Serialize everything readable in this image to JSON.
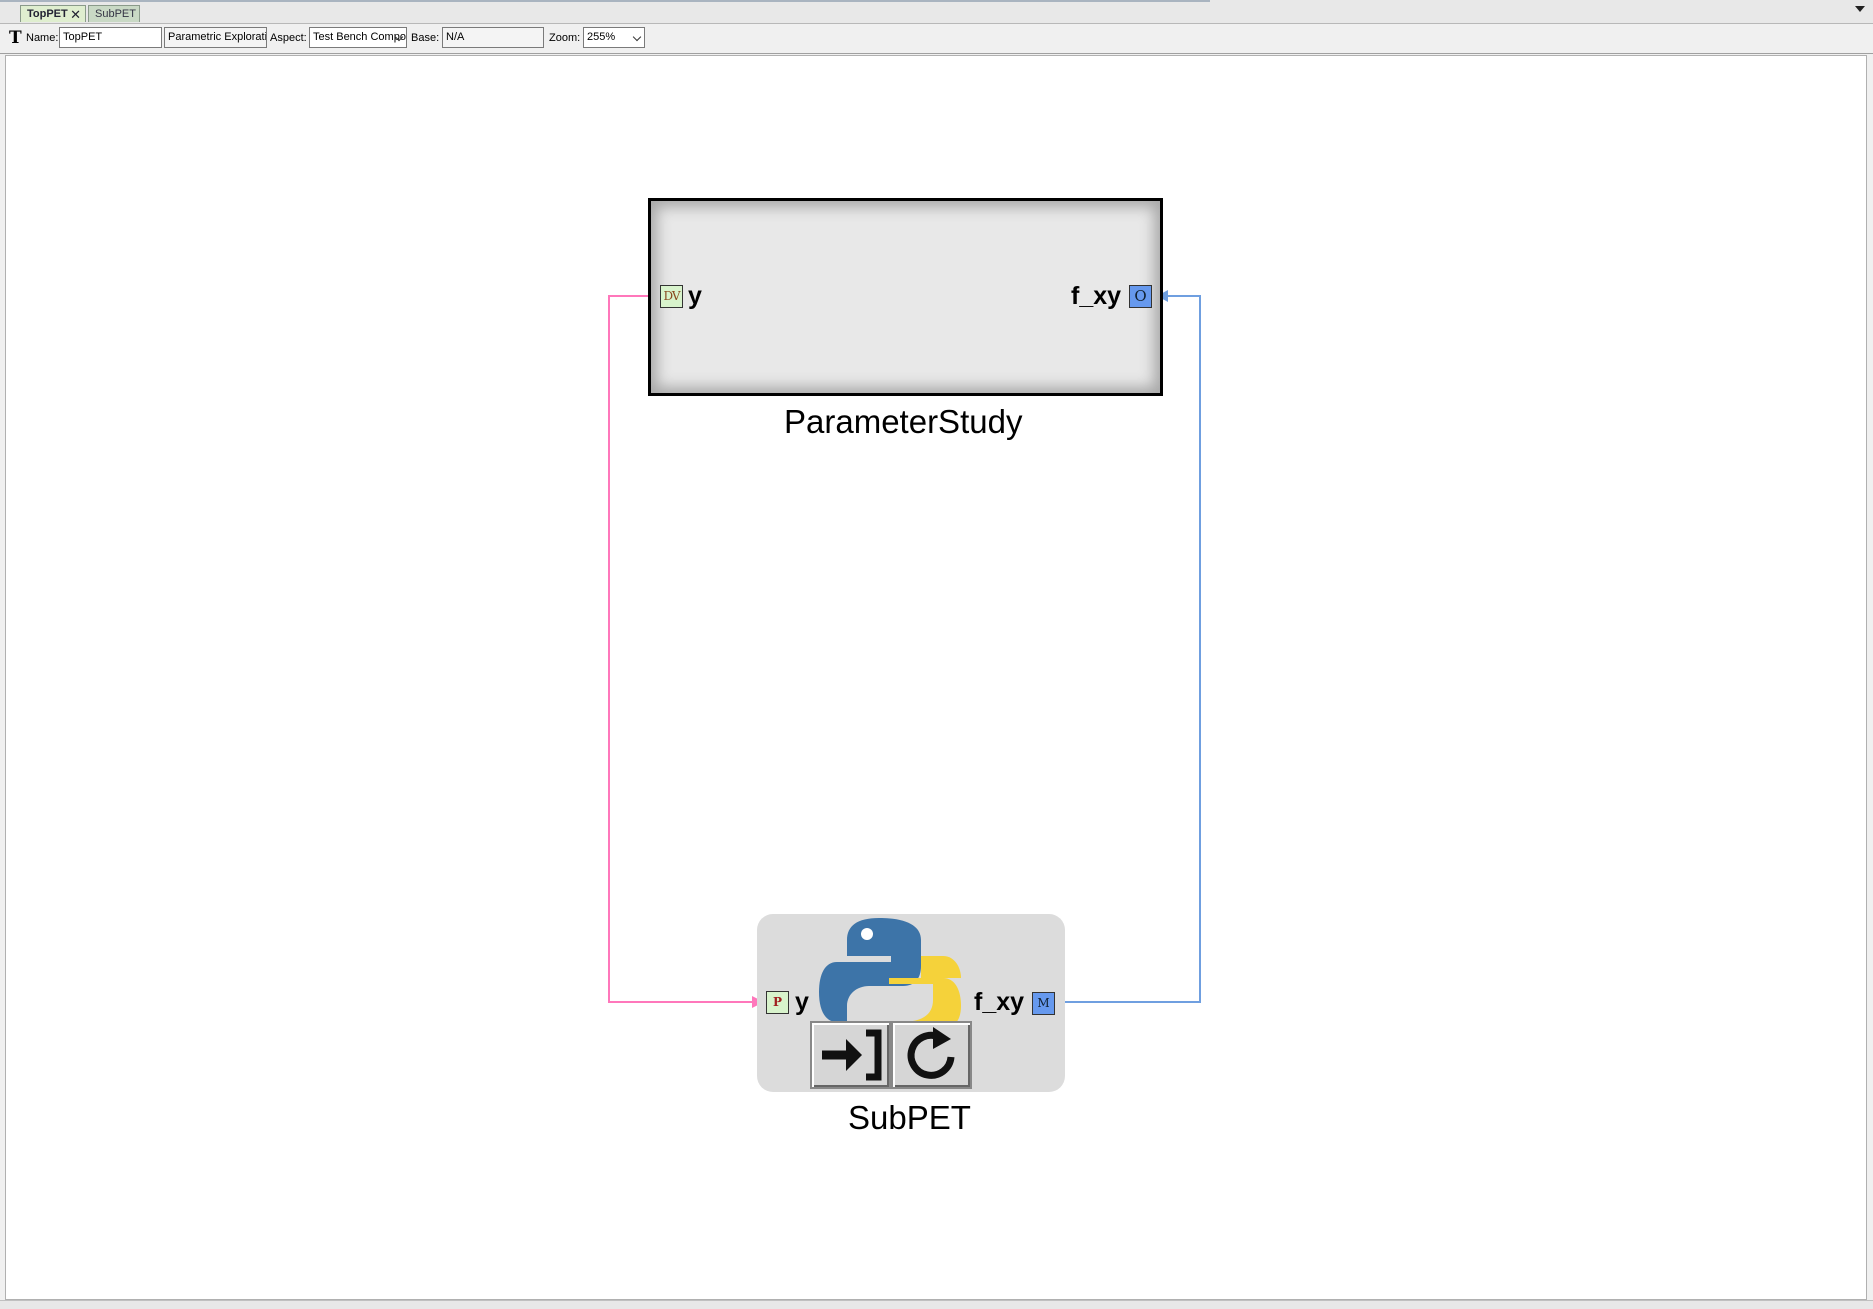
{
  "tabs": [
    {
      "label": "TopPET",
      "active": true,
      "close": "✕"
    },
    {
      "label": "SubPET",
      "active": false
    }
  ],
  "toolbar": {
    "text_tool_glyph": "T",
    "name_label": "Name:",
    "name_value": "TopPET",
    "kind_value": "Parametric Exploration",
    "aspect_label": "Aspect:",
    "aspect_value": "Test Bench Composition",
    "base_label": "Base:",
    "base_value": "N/A",
    "zoom_label": "Zoom:",
    "zoom_value": "255%"
  },
  "diagram": {
    "parameter_study": {
      "name": "ParameterStudy",
      "in_port": {
        "badge": "DV",
        "label": "y"
      },
      "out_port": {
        "badge": "O",
        "label": "f_xy"
      }
    },
    "sub_pet": {
      "name": "SubPET",
      "icon": "python-logo-icon",
      "in_port": {
        "badge": "P",
        "label": "y"
      },
      "out_port": {
        "badge": "M",
        "label": "f_xy"
      },
      "buttons": [
        "enter-icon",
        "refresh-icon"
      ]
    },
    "wire_colors": {
      "y": "#ff77bb",
      "f_xy": "#6f9fe0"
    }
  }
}
